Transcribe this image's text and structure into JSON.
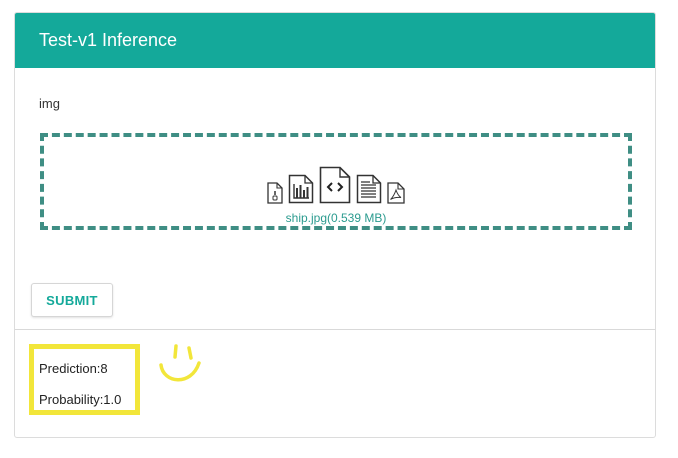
{
  "header": {
    "title": "Test-v1 Inference",
    "background_color": "#14a99a"
  },
  "form": {
    "field_label": "img",
    "upload": {
      "file_name": "ship.jpg(0.539 MB)",
      "icons": [
        "zip-file-icon",
        "chart-file-icon",
        "code-file-icon",
        "text-file-icon",
        "pdf-file-icon"
      ]
    },
    "submit_label": "SUBMIT"
  },
  "result": {
    "prediction": "Prediction:8",
    "probability": "Probability:1.0",
    "highlight_color": "#f2e63a"
  }
}
